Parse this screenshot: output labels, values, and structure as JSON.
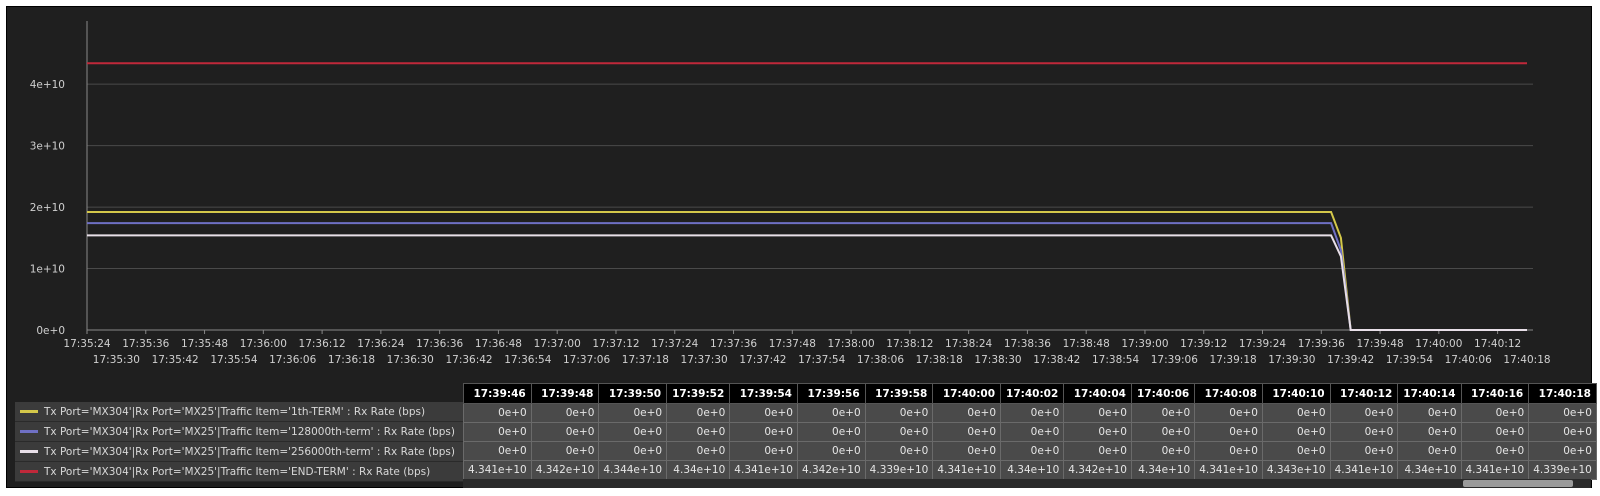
{
  "chart_data": {
    "type": "line",
    "title": "",
    "xlabel": "",
    "ylabel": "",
    "ylim": [
      0,
      48000000000
    ],
    "grid": true,
    "y_ticks": [
      "0e+0",
      "1e+10",
      "2e+10",
      "3e+10",
      "4e+10"
    ],
    "x_ticks_row1": [
      "17:35:24",
      "17:35:36",
      "17:35:48",
      "17:36:00",
      "17:36:12",
      "17:36:24",
      "17:36:36",
      "17:36:48",
      "17:37:00",
      "17:37:12",
      "17:37:24",
      "17:37:36",
      "17:37:48",
      "17:38:00",
      "17:38:12",
      "17:38:24",
      "17:38:36",
      "17:38:48",
      "17:39:00",
      "17:39:12",
      "17:39:24",
      "17:39:36",
      "17:39:48",
      "17:40:00",
      "17:40:12"
    ],
    "x_ticks_row2": [
      "17:35:30",
      "17:35:42",
      "17:35:54",
      "17:36:06",
      "17:36:18",
      "17:36:30",
      "17:36:42",
      "17:36:54",
      "17:37:06",
      "17:37:18",
      "17:37:30",
      "17:37:42",
      "17:37:54",
      "17:38:06",
      "17:38:18",
      "17:38:30",
      "17:38:42",
      "17:38:54",
      "17:39:06",
      "17:39:18",
      "17:39:30",
      "17:39:42",
      "17:39:54",
      "17:40:06",
      "17:40:18"
    ],
    "x": [
      "17:35:24",
      "17:39:38",
      "17:39:40",
      "17:39:42",
      "17:40:18"
    ],
    "series": [
      {
        "name": "Tx Port='MX304'|Rx Port='MX25'|Traffic Item='1th-TERM' : Rx Rate (bps)",
        "color": "#d4c84a",
        "values": [
          19200000000,
          19200000000,
          15000000000,
          0,
          0
        ]
      },
      {
        "name": "Tx Port='MX304'|Rx Port='MX25'|Traffic Item='128000th-term' : Rx Rate (bps)",
        "color": "#6f70c4",
        "values": [
          17400000000,
          17400000000,
          13000000000,
          0,
          0
        ]
      },
      {
        "name": "Tx Port='MX304'|Rx Port='MX25'|Traffic Item='256000th-term' : Rx Rate (bps)",
        "color": "#e8dfe8",
        "values": [
          15400000000,
          15400000000,
          12000000000,
          0,
          0
        ]
      },
      {
        "name": "Tx Port='MX304'|Rx Port='MX25'|Traffic Item='END-TERM' : Rx Rate (bps)",
        "color": "#c0283a",
        "values": [
          43400000000,
          43400000000,
          43400000000,
          43400000000,
          43400000000
        ]
      }
    ]
  },
  "table": {
    "headers": [
      "17:39:46",
      "17:39:48",
      "17:39:50",
      "17:39:52",
      "17:39:54",
      "17:39:56",
      "17:39:58",
      "17:40:00",
      "17:40:02",
      "17:40:04",
      "17:40:06",
      "17:40:08",
      "17:40:10",
      "17:40:12",
      "17:40:14",
      "17:40:16",
      "17:40:18"
    ],
    "rows": [
      [
        "0e+0",
        "0e+0",
        "0e+0",
        "0e+0",
        "0e+0",
        "0e+0",
        "0e+0",
        "0e+0",
        "0e+0",
        "0e+0",
        "0e+0",
        "0e+0",
        "0e+0",
        "0e+0",
        "0e+0",
        "0e+0",
        "0e+0"
      ],
      [
        "0e+0",
        "0e+0",
        "0e+0",
        "0e+0",
        "0e+0",
        "0e+0",
        "0e+0",
        "0e+0",
        "0e+0",
        "0e+0",
        "0e+0",
        "0e+0",
        "0e+0",
        "0e+0",
        "0e+0",
        "0e+0",
        "0e+0"
      ],
      [
        "0e+0",
        "0e+0",
        "0e+0",
        "0e+0",
        "0e+0",
        "0e+0",
        "0e+0",
        "0e+0",
        "0e+0",
        "0e+0",
        "0e+0",
        "0e+0",
        "0e+0",
        "0e+0",
        "0e+0",
        "0e+0",
        "0e+0"
      ],
      [
        "4.341e+10",
        "4.342e+10",
        "4.344e+10",
        "4.34e+10",
        "4.341e+10",
        "4.342e+10",
        "4.339e+10",
        "4.341e+10",
        "4.34e+10",
        "4.342e+10",
        "4.34e+10",
        "4.341e+10",
        "4.343e+10",
        "4.341e+10",
        "4.34e+10",
        "4.341e+10",
        "4.339e+10"
      ]
    ]
  },
  "colors": {
    "background": "#1f1f1f",
    "grid": "#4a4a4a",
    "axis_text": "#d0d0d0"
  }
}
